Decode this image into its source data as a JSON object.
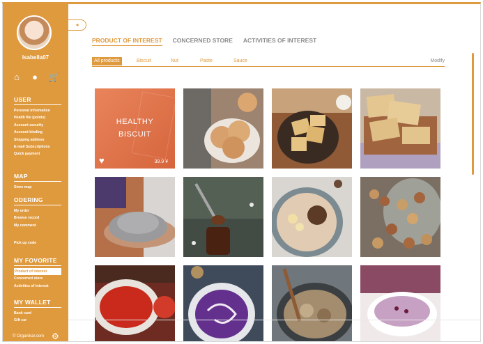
{
  "user": {
    "username": "Isabella07"
  },
  "quick_icons": [
    "home-icon",
    "user-icon",
    "cart-icon"
  ],
  "sidebar": {
    "user": {
      "title": "USER",
      "items": [
        "Personal information",
        "Health file (points)",
        "Account security",
        "Account binding",
        "Shipping address",
        "E-mail Subscriptions",
        "Quick payment"
      ]
    },
    "map": {
      "title": "MAP",
      "items": [
        "Store map"
      ]
    },
    "ordering": {
      "title": "ODERING",
      "items": [
        "My order",
        "Browse record",
        "My comment"
      ]
    },
    "pickup": "Pick up  code",
    "favorite": {
      "title": "MY FOVORITE",
      "items": [
        "Product of interest",
        "Concerned store",
        "Activities of interest"
      ],
      "active_index": 0
    },
    "wallet": {
      "title": "MY WALLET",
      "items": [
        "Bank card",
        "Gift car"
      ]
    },
    "brand": "© Organikar.com"
  },
  "back_button": "◂",
  "tabs": [
    "PRODUCT OF INTEREST",
    "CONCERNED STORE",
    "ACTIVITIES OF INTEREST"
  ],
  "active_tab": 0,
  "subtabs": [
    "All products",
    "Biscuit",
    "Nut",
    "Paste",
    "Sauce"
  ],
  "active_subtab": 0,
  "modify_label": "Modify",
  "featured": {
    "line1": "HEALTHY",
    "line2": "BISCUIT",
    "price": "39.9 ¥"
  },
  "products": [
    {
      "name": "featured-biscuit"
    },
    {
      "name": "round-cookies"
    },
    {
      "name": "square-crackers"
    },
    {
      "name": "thin-crackers"
    },
    {
      "name": "grain-powder"
    },
    {
      "name": "spoon-sauce"
    },
    {
      "name": "nut-porridge"
    },
    {
      "name": "mixed-nuts-jar"
    },
    {
      "name": "tomato-paste"
    },
    {
      "name": "purple-soup"
    },
    {
      "name": "grain-bowl"
    },
    {
      "name": "berry-yogurt"
    }
  ],
  "colors": {
    "accent": "#e09a3e",
    "featured": "#d96a40",
    "muted": "#8b8b8b"
  }
}
